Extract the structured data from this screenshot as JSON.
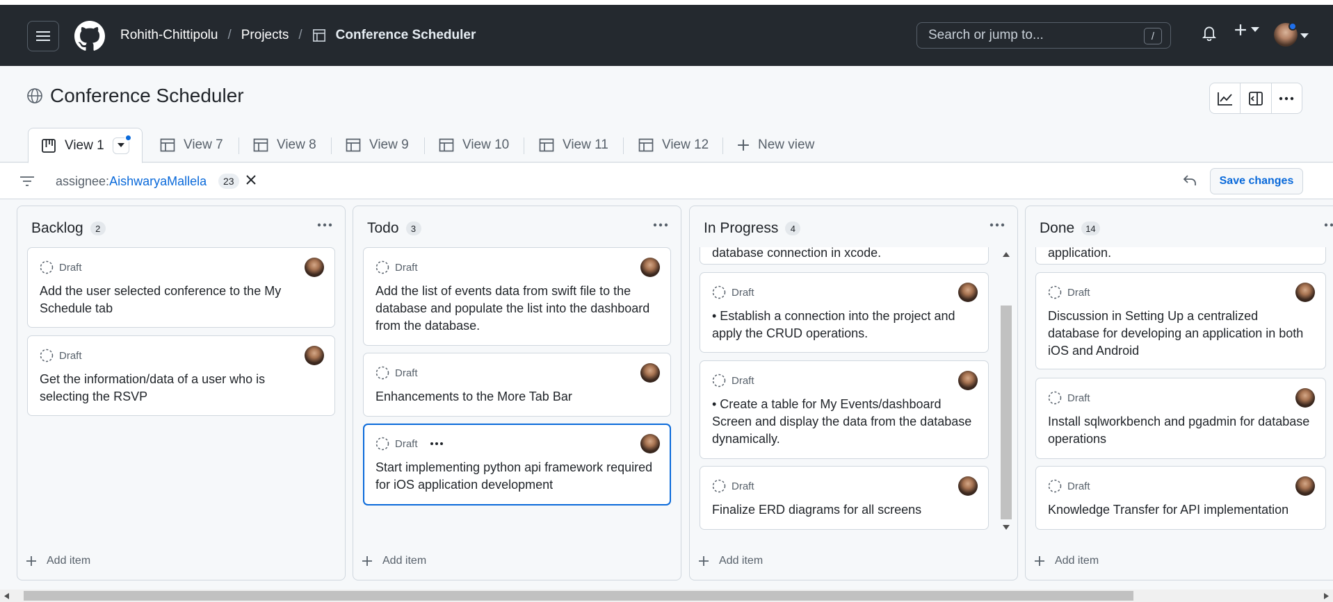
{
  "header": {
    "owner": "Rohith-Chittipolu",
    "projects": "Projects",
    "project_name": "Conference Scheduler",
    "search_placeholder": "Search or jump to...",
    "search_kbd": "/"
  },
  "page": {
    "title": "Conference Scheduler"
  },
  "tabs": [
    {
      "label": "View 1"
    },
    {
      "label": "View 7"
    },
    {
      "label": "View 8"
    },
    {
      "label": "View 9"
    },
    {
      "label": "View 10"
    },
    {
      "label": "View 11"
    },
    {
      "label": "View 12"
    },
    {
      "label": "New view"
    }
  ],
  "filter": {
    "key": "assignee:",
    "value": "AishwaryaMallela",
    "count": "23",
    "save_label": "Save changes"
  },
  "columns": [
    {
      "name": "Backlog",
      "count": "2",
      "cards": [
        {
          "status": "Draft",
          "title": "Add the user selected conference to the My Schedule tab"
        },
        {
          "status": "Draft",
          "title": "Get the information/data of a user who is selecting the RSVP"
        }
      ]
    },
    {
      "name": "Todo",
      "count": "3",
      "cards": [
        {
          "status": "Draft",
          "title": "Add the list of events data from swift file to the database and populate the list into the dashboard from the database."
        },
        {
          "status": "Draft",
          "title": "Enhancements to the More Tab Bar"
        },
        {
          "status": "Draft",
          "title": "Start implementing python api framework required for iOS application development"
        }
      ]
    },
    {
      "name": "In Progress",
      "count": "4",
      "partial_top": "database connection in xcode.",
      "cards": [
        {
          "status": "Draft",
          "title": "• Establish a connection into the project and apply the CRUD operations."
        },
        {
          "status": "Draft",
          "title": "• Create a table for My Events/dashboard Screen and display the data from the database dynamically."
        },
        {
          "status": "Draft",
          "title": "Finalize ERD diagrams for all screens"
        }
      ]
    },
    {
      "name": "Done",
      "count": "14",
      "partial_top": "application.",
      "cards": [
        {
          "status": "Draft",
          "title": "Discussion in Setting Up a centralized database for developing an application in both iOS and Android"
        },
        {
          "status": "Draft",
          "title": "Install sqlworkbench and pgadmin for database operations"
        },
        {
          "status": "Draft",
          "title": "Knowledge Transfer for API implementation"
        }
      ]
    }
  ],
  "add_item_label": "Add item",
  "colors": {
    "header_bg": "#24292f",
    "accent": "#0969da",
    "border": "#d0d7de"
  }
}
